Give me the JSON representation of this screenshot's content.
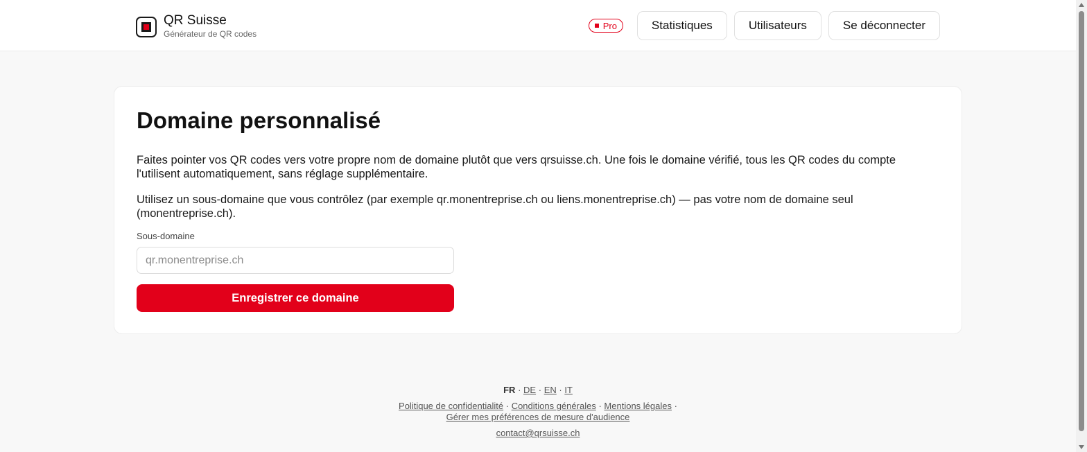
{
  "header": {
    "brand_name": "QR Suisse",
    "brand_tagline": "Générateur de QR codes",
    "plan_badge": "Pro",
    "nav": {
      "stats": "Statistiques",
      "users": "Utilisateurs",
      "logout": "Se déconnecter"
    }
  },
  "main": {
    "title": "Domaine personnalisé",
    "intro": "Faites pointer vos QR codes vers votre propre nom de domaine plutôt que vers qrsuisse.ch. Une fois le domaine vérifié, tous les QR codes du compte l'utilisent automatiquement, sans réglage supplémentaire.",
    "hint": "Utilisez un sous-domaine que vous contrôlez (par exemple qr.monentreprise.ch ou liens.monentreprise.ch) — pas votre nom de domaine seul (monentreprise.ch).",
    "field_label": "Sous-domaine",
    "field_placeholder": "qr.monentreprise.ch",
    "field_value": "",
    "submit_label": "Enregistrer ce domaine"
  },
  "footer": {
    "languages": {
      "current": "FR",
      "others": [
        "DE",
        "EN",
        "IT"
      ]
    },
    "separator": "·",
    "links": {
      "privacy": "Politique de confidentialité",
      "terms": "Conditions générales",
      "legal": "Mentions légales",
      "audience": "Gérer mes préférences de mesure d'audience"
    },
    "contact": "contact@qrsuisse.ch"
  },
  "colors": {
    "accent": "#e2001a",
    "background": "#f8f8f8",
    "card": "#ffffff"
  }
}
